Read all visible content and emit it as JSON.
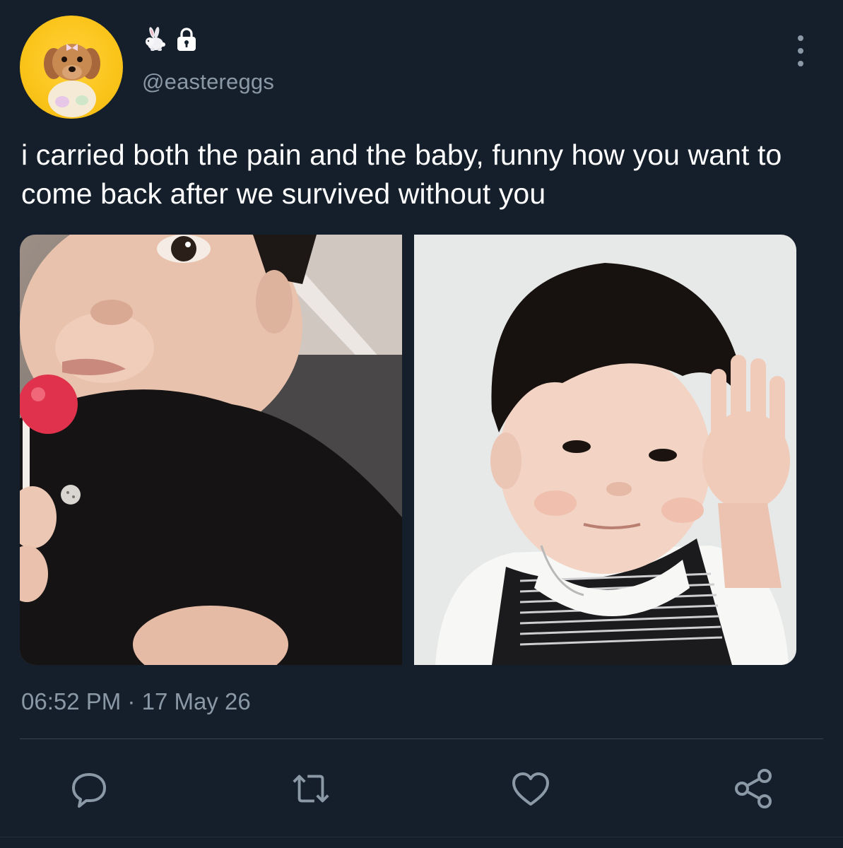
{
  "tweet": {
    "display_name_icons": [
      "rabbit-icon",
      "lock-icon"
    ],
    "handle": "@eastereggs",
    "text": "i carried both the pain and the baby, funny how you want to come back after we survived without you",
    "time": "06:52 PM",
    "separator": "·",
    "date": "17 May 26"
  },
  "actions": [
    "reply-icon",
    "retweet-icon",
    "like-icon",
    "share-icon"
  ],
  "colors": {
    "background": "#151f2b",
    "text": "#ffffff",
    "secondary": "#8b98a5",
    "divider": "#38444d",
    "avatar": "#fbc51d"
  }
}
